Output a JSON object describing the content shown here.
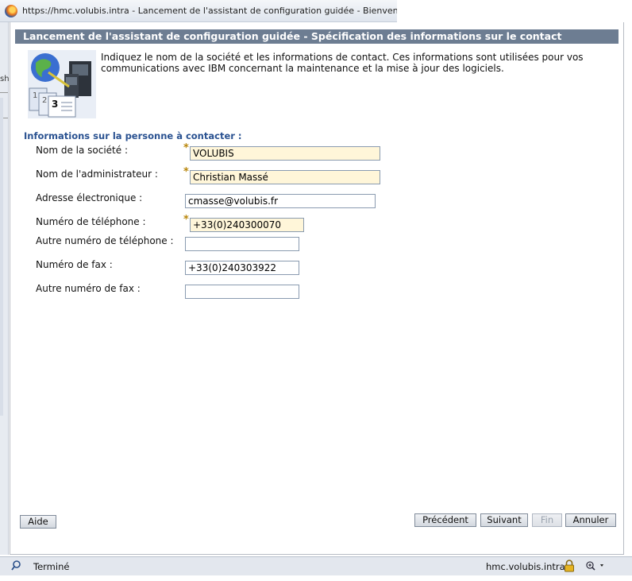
{
  "browser": {
    "title": "https://hmc.volubis.intra - Lancement de l'assistant de configuration guidée - Bienvenue"
  },
  "background_window": {
    "text": "sh"
  },
  "dialog": {
    "title": "Lancement de l'assistant de configuration guidée - Spécification des informations sur le contact",
    "intro": "Indiquez le nom de la société et les informations de contact. Ces informations sont utilisées pour vos communications avec IBM concernant la maintenance et la mise à jour des logiciels.",
    "icon": "setup-wizard-icon",
    "section_label": "Informations sur la personne à contacter :",
    "required_marker": "*",
    "fields": {
      "company": {
        "label": "Nom de la société :",
        "value": "VOLUBIS",
        "required": true
      },
      "admin": {
        "label": "Nom de l'administrateur :",
        "value": "Christian Massé",
        "required": true
      },
      "email": {
        "label": "Adresse électronique :",
        "value": "cmasse@volubis.fr",
        "required": false
      },
      "phone": {
        "label": "Numéro de téléphone :",
        "value": "+33(0)240300070",
        "required": true
      },
      "alt_phone": {
        "label": "Autre numéro de téléphone :",
        "value": "",
        "required": false
      },
      "fax": {
        "label": "Numéro de fax :",
        "value": "+33(0)240303922",
        "required": false
      },
      "alt_fax": {
        "label": "Autre numéro de fax :",
        "value": "",
        "required": false
      }
    },
    "buttons": {
      "help": "Aide",
      "previous": "Précédent",
      "next": "Suivant",
      "finish": "Fin",
      "cancel": "Annuler"
    },
    "colors": {
      "header_bg": "#6d7d92",
      "section_label": "#2a5291",
      "required_field_bg": "#fff6d9",
      "required_marker": "#b8860b"
    }
  },
  "statusbar": {
    "status": "Terminé",
    "host": "hmc.volubis.intra"
  }
}
